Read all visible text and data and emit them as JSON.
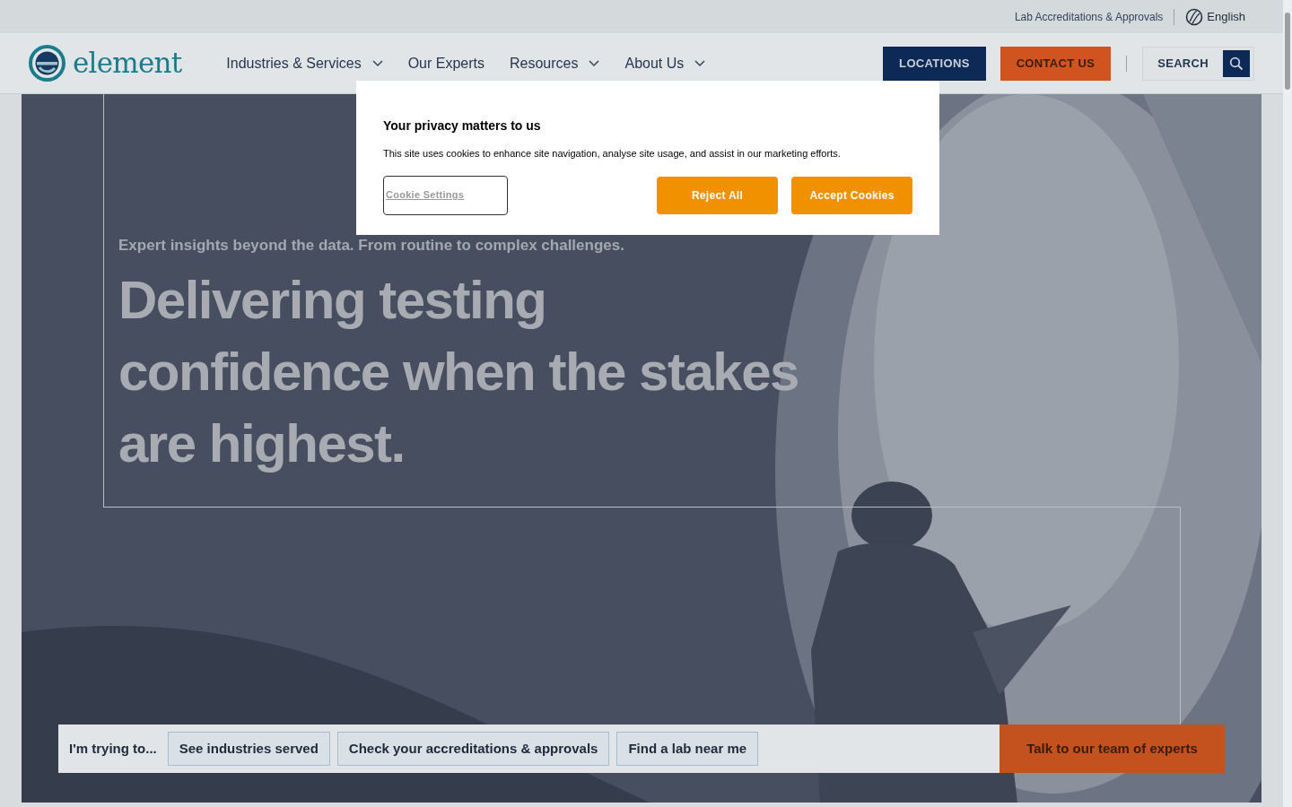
{
  "top_bar": {
    "links": [
      {
        "label": "Lab Accreditations & Approvals"
      }
    ],
    "language": {
      "label": "English"
    }
  },
  "header": {
    "logo": {
      "text": "element"
    },
    "nav": [
      {
        "label": "Industries & Services",
        "has_menu": true
      },
      {
        "label": "Our Experts",
        "has_menu": false
      },
      {
        "label": "Resources",
        "has_menu": true
      },
      {
        "label": "About Us",
        "has_menu": true
      }
    ],
    "buttons": [
      {
        "label": "LOCATIONS",
        "kind": "navy"
      },
      {
        "label": "CONTACT US",
        "kind": "orange"
      }
    ],
    "search": {
      "label": "SEARCH"
    }
  },
  "hero": {
    "eyebrow": "Expert insights beyond the data. From routine to complex challenges.",
    "heading": "Delivering testing confidence when the stakes are highest."
  },
  "quick_links": {
    "prompt": "I'm trying to...",
    "links": [
      {
        "label": "See industries served"
      },
      {
        "label": "Check your accreditations & approvals"
      },
      {
        "label": "Find a lab near me"
      }
    ],
    "cta": "Talk to our team of experts"
  },
  "cookie_dialog": {
    "title": "Your privacy matters to us",
    "body": "This site uses cookies to enhance site navigation, analyse site usage, and assist in our marketing efforts.",
    "buttons": [
      {
        "label": "Cookie Settings",
        "kind": "settings"
      },
      {
        "label": "Reject All",
        "kind": "primary"
      },
      {
        "label": "Accept Cookies",
        "kind": "primary"
      }
    ]
  }
}
